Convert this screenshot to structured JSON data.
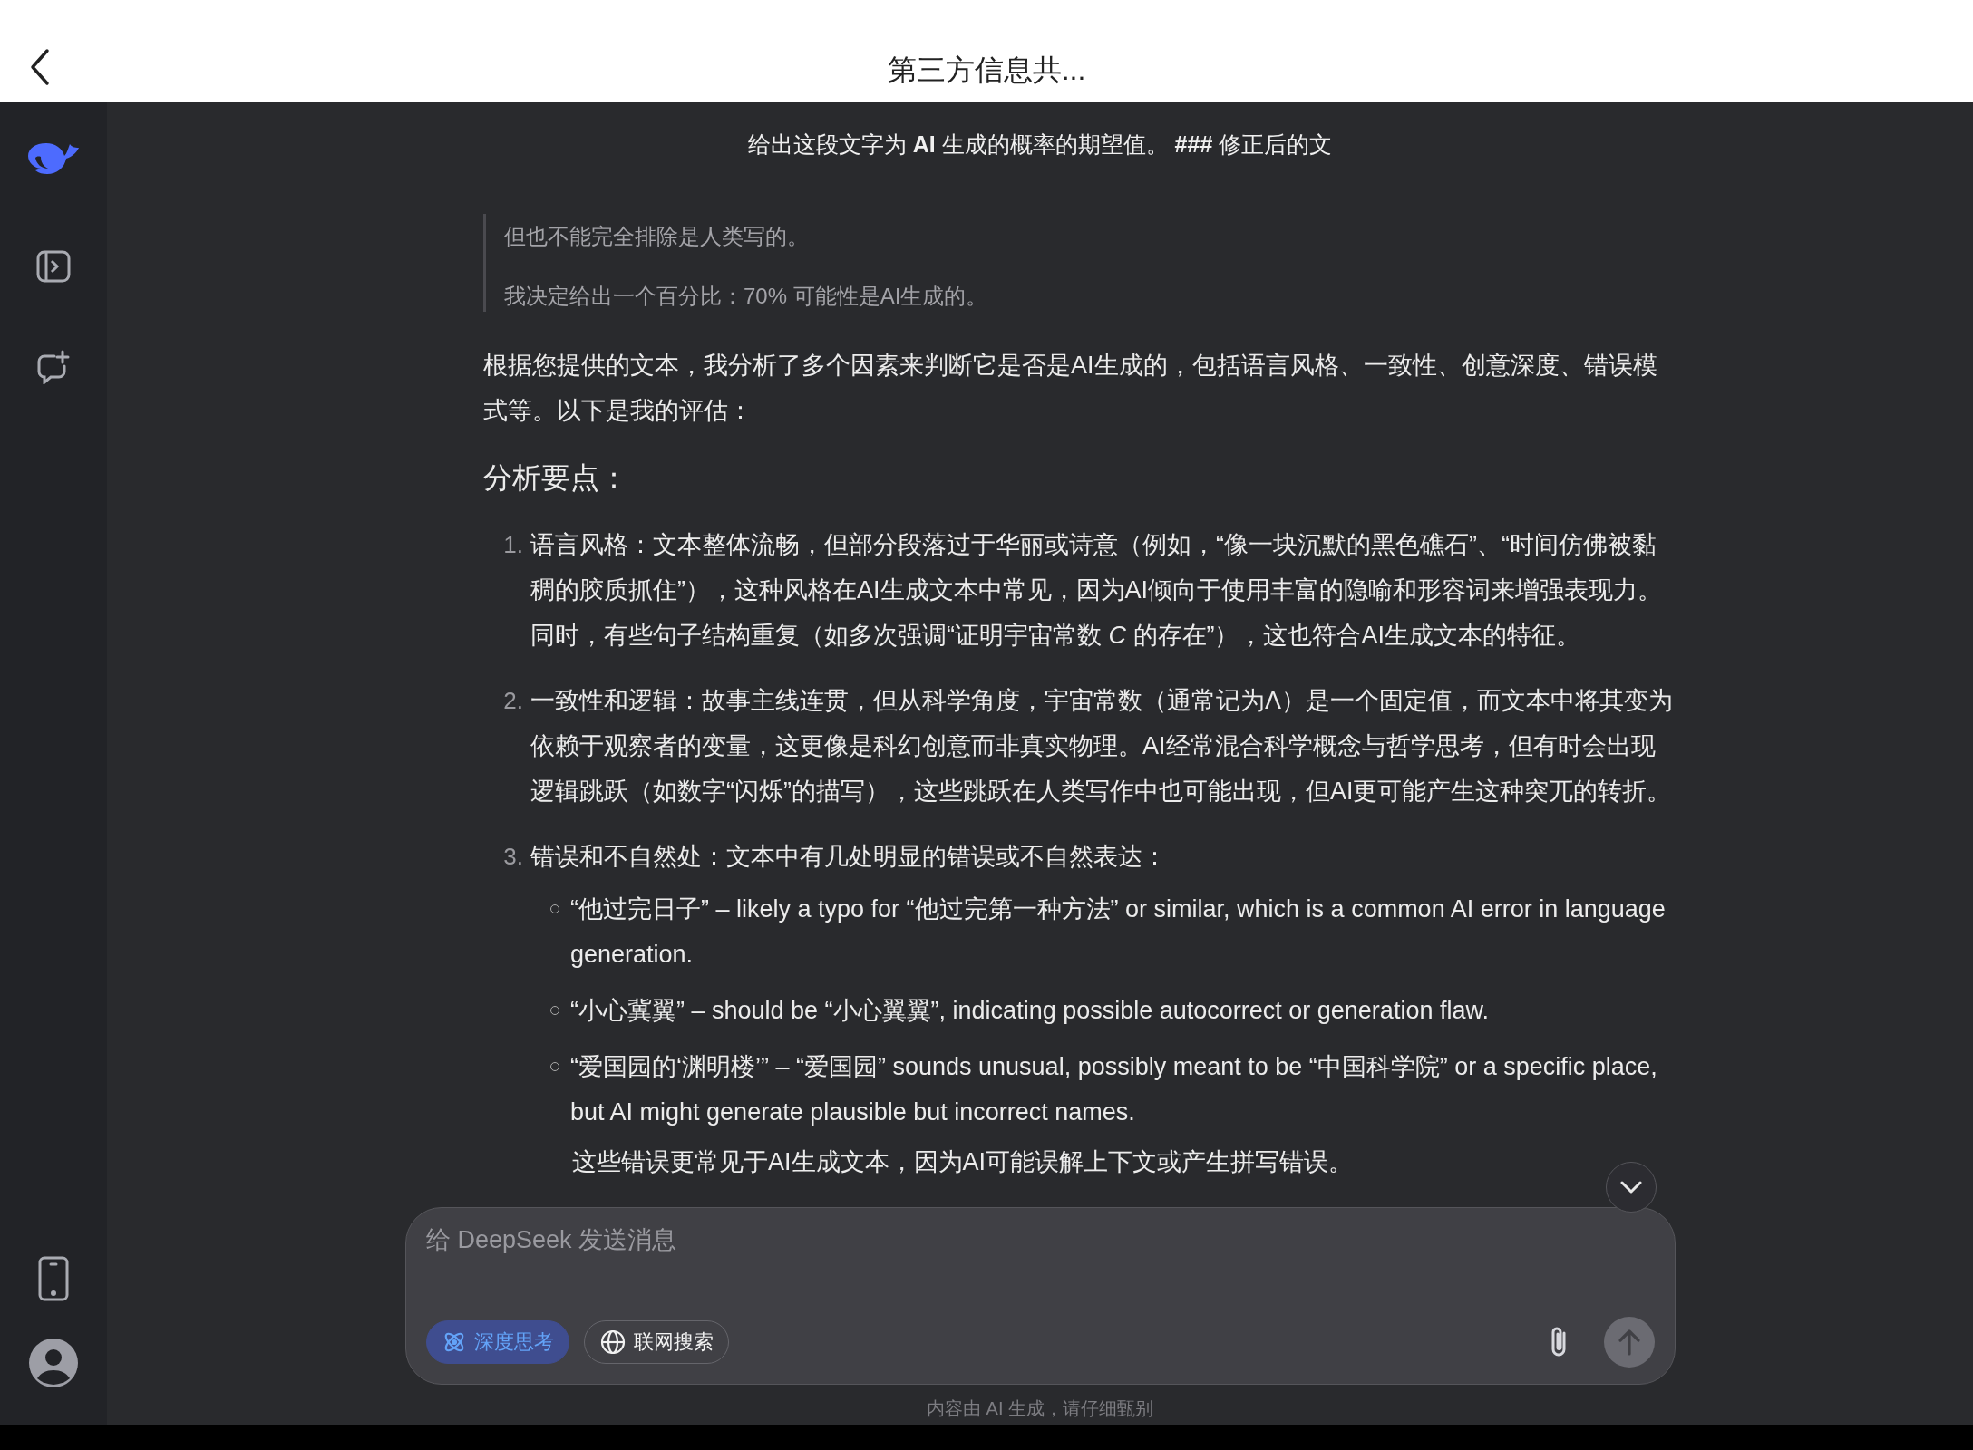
{
  "header": {
    "title": "第三方信息共..."
  },
  "chat": {
    "title": "给出这段文字为 **AI** 生成的概率的期望值。 **###** 修正后的文",
    "quote": [
      "但也不能完全排除是人类写的。",
      "我决定给出一个百分比：70% 可能性是AI生成的。"
    ],
    "intro": "根据您提供的文本，我分析了多个因素来判断它是否是AI生成的，包括语言风格、一致性、创意深度、错误模式等。以下是我的评估：",
    "section_heading": "分析要点：",
    "items": [
      {
        "number": "1.",
        "text": "语言风格：文本整体流畅，但部分段落过于华丽或诗意（例如，“像一块沉默的黑色礁石”、“时间仿佛被黏稠的胶质抓住”），这种风格在AI生成文本中常见，因为AI倾向于使用丰富的隐喻和形容词来增强表现力。同时，有些句子结构重复（如多次强调“证明宇宙常数 *C* 的存在”），这也符合AI生成文本的特征。"
      },
      {
        "number": "2.",
        "text": "一致性和逻辑：故事主线连贯，但从科学角度，宇宙常数（通常记为Λ）是一个固定值，而文本中将其变为依赖于观察者的变量，这更像是科幻创意而非真实物理。AI经常混合科学概念与哲学思考，但有时会出现逻辑跳跃（如数字“闪烁”的描写），这些跳跃在人类写作中也可能出现，但AI更可能产生这种突兀的转折。"
      },
      {
        "number": "3.",
        "text": "错误和不自然处：文本中有几处明显的错误或不自然表达：",
        "bullets": [
          "“他过完日子” – likely a typo for “他过完第一种方法” or similar, which is a common AI error in language generation.",
          "“小心冀翼” – should be “小心翼翼”, indicating possible autocorrect or generation flaw.",
          "“爱国园的‘渊明楼’” – “爱国园” sounds unusual, possibly meant to be “中国科学院” or a specific place, but AI might generate plausible but incorrect names."
        ],
        "note": "这些错误更常见于AI生成文本，因为AI可能误解上下文或产生拼写错误。"
      }
    ]
  },
  "composer": {
    "placeholder": "给 DeepSeek 发送消息",
    "toggles": [
      {
        "kind": "deep-think",
        "label": "深度思考",
        "selected": true
      },
      {
        "kind": "web-search",
        "label": "联网搜索",
        "selected": false
      }
    ]
  },
  "disclaimer": "内容由 AI 生成，请仔细甄别"
}
